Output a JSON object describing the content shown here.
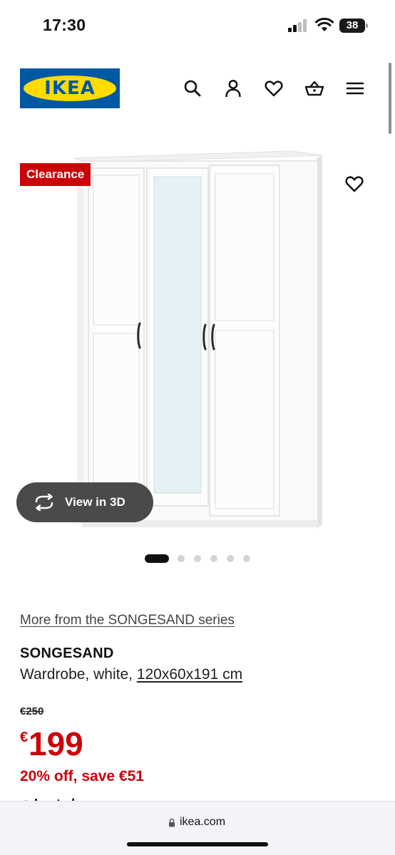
{
  "status_bar": {
    "time": "17:30",
    "battery": "38",
    "icons": [
      "signal-icon",
      "wifi-icon",
      "battery-icon"
    ]
  },
  "header": {
    "logo_text": "IKEA",
    "icons": [
      "search-icon",
      "user-icon",
      "heart-icon",
      "basket-icon",
      "menu-icon"
    ],
    "colors": {
      "logo_blue": "#0058a3",
      "logo_yellow": "#ffdb00"
    }
  },
  "gallery": {
    "badge": "Clearance",
    "view_3d_label": "View in 3D",
    "image_count": 6,
    "active_index": 0
  },
  "product": {
    "series_link": "More from the SONGESAND series",
    "name": "SONGESAND",
    "description": "Wardrobe, white, ",
    "size": "120x60x191 cm",
    "old_price": "€250",
    "currency": "€",
    "price": "199",
    "discount": "20% off, save €51",
    "last_chance": "Last chance"
  },
  "browser": {
    "url": "ikea.com"
  },
  "colors": {
    "sale_red": "#cc0008",
    "text": "#111111",
    "view_3d_bg": "#4a4a4a"
  }
}
